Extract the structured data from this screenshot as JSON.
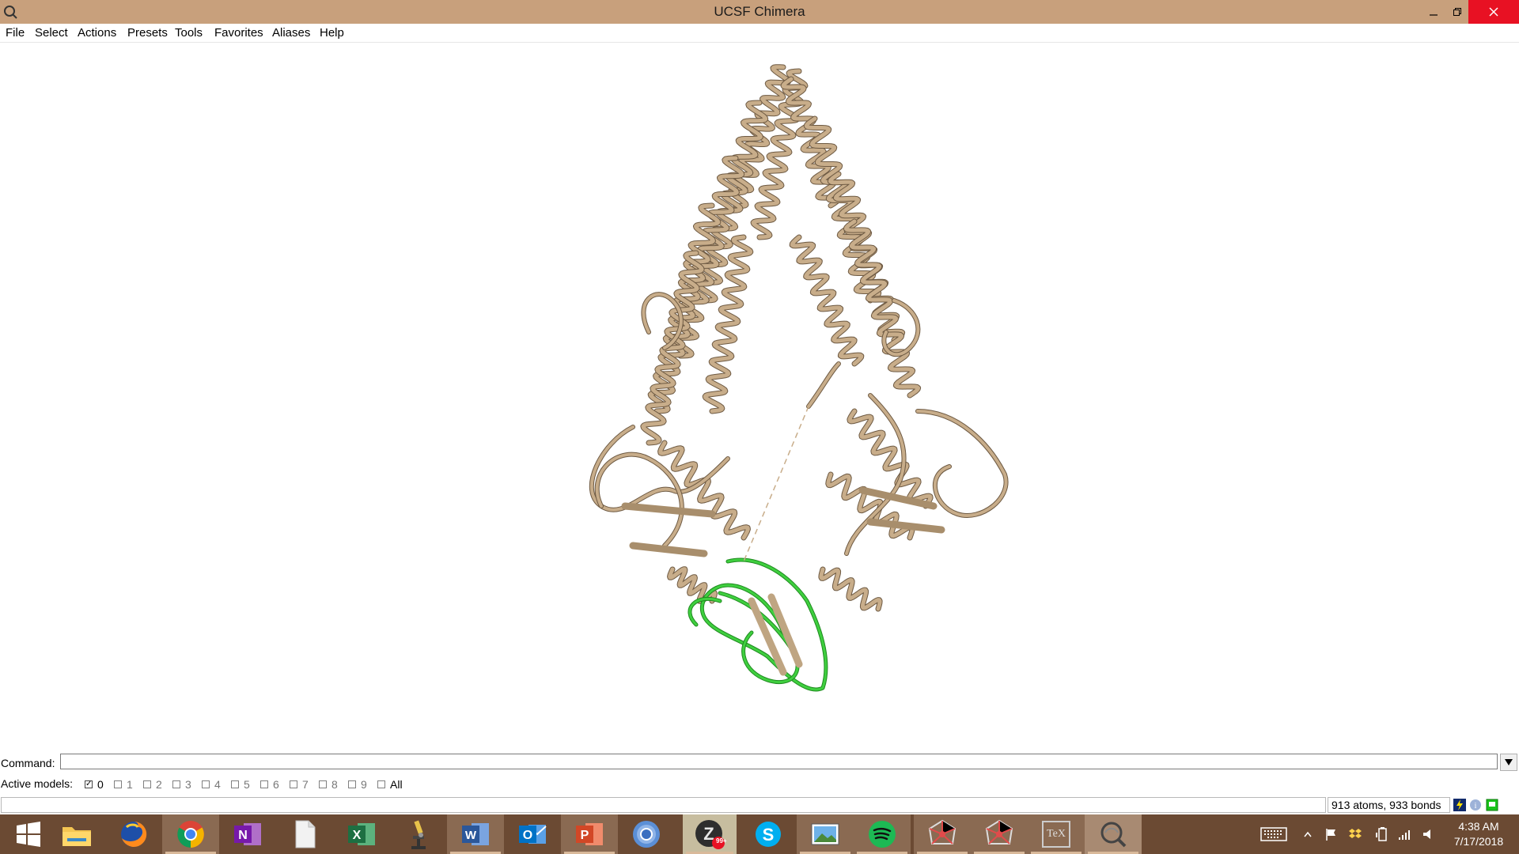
{
  "window": {
    "title": "UCSF Chimera"
  },
  "menu": {
    "items": [
      "File",
      "Select",
      "Actions",
      "Presets",
      "Tools",
      "Favorites",
      "Aliases",
      "Help"
    ]
  },
  "command": {
    "label": "Command:",
    "value": ""
  },
  "active_models": {
    "label": "Active models:",
    "models": [
      {
        "label": "0",
        "checked": true
      },
      {
        "label": "1",
        "checked": false
      },
      {
        "label": "2",
        "checked": false
      },
      {
        "label": "3",
        "checked": false
      },
      {
        "label": "4",
        "checked": false
      },
      {
        "label": "5",
        "checked": false
      },
      {
        "label": "6",
        "checked": false
      },
      {
        "label": "7",
        "checked": false
      },
      {
        "label": "8",
        "checked": false
      },
      {
        "label": "9",
        "checked": false
      },
      {
        "label": "All",
        "checked": false
      }
    ]
  },
  "status": {
    "message": "",
    "counts": "913 atoms, 933 bonds"
  },
  "molecule": {
    "main_color": "#c8ad8a",
    "selected_color": "#3fcf3f"
  },
  "taskbar": {
    "apps": [
      {
        "name": "start",
        "icon": "windows-icon"
      },
      {
        "name": "file-explorer",
        "icon": "folder-icon"
      },
      {
        "name": "firefox",
        "icon": "firefox-icon"
      },
      {
        "name": "chrome",
        "icon": "chrome-icon"
      },
      {
        "name": "onenote",
        "icon": "onenote-icon"
      },
      {
        "name": "notepad",
        "icon": "document-icon"
      },
      {
        "name": "excel",
        "icon": "excel-icon"
      },
      {
        "name": "microscope",
        "icon": "microscope-icon"
      },
      {
        "name": "word",
        "icon": "word-icon"
      },
      {
        "name": "outlook",
        "icon": "outlook-icon"
      },
      {
        "name": "powerpoint",
        "icon": "powerpoint-icon"
      },
      {
        "name": "chromium",
        "icon": "chromium-icon"
      },
      {
        "name": "zotero",
        "icon": "zotero-icon",
        "badge": "99+"
      },
      {
        "name": "skype",
        "icon": "skype-icon"
      },
      {
        "name": "photos",
        "icon": "photos-icon"
      },
      {
        "name": "spotify",
        "icon": "spotify-icon"
      },
      {
        "name": "molecule-app-1",
        "icon": "molecule-net-icon"
      },
      {
        "name": "molecule-app-2",
        "icon": "molecule-net-icon"
      },
      {
        "name": "texmaker",
        "icon": "texmaker-icon",
        "text": "TeX"
      },
      {
        "name": "chimera",
        "icon": "chimera-icon"
      }
    ],
    "clock": {
      "time": "4:38 AM",
      "date": "7/17/2018"
    }
  }
}
